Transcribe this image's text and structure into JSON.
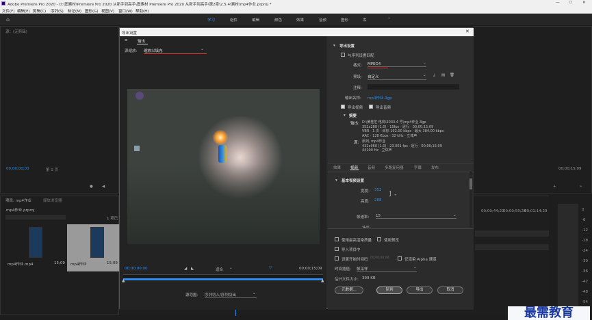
{
  "titlebar": {
    "title": "Adobe Premiere Pro 2020 - D:\\图素材\\Premiere Pro 2020 从新手到高手\\图素材 Premiere Pro 2020 从新手到高手\\第2章\\2.5.4\\素材\\mp4作业.prproj *"
  },
  "menu": [
    "文件(F)",
    "编辑(E)",
    "剪辑(C)",
    "序列(S)",
    "标记(M)",
    "图形(G)",
    "视图(V)",
    "窗口(W)",
    "帮助(H)"
  ],
  "workspaces": [
    "学习",
    "组件",
    "编辑",
    "颜色",
    "效果",
    "音频",
    "图形",
    "库"
  ],
  "panels": {
    "source": "源：(无剪辑)",
    "source_tc": "00;00;00;00",
    "source_page": "第 1 页",
    "program_tc": "00;00;15;09",
    "project_tabs": [
      "项目: mp4作业",
      "媒体浏览器"
    ],
    "project_file": "mp4作业.prproj",
    "items_count": "1 项已",
    "media": [
      {
        "name": "mp4作业.mp4",
        "dur": "15;09"
      },
      {
        "name": "mp4作业",
        "dur": "15;09"
      }
    ],
    "timeline_tcs": [
      "00;00;44;29",
      "00;00;59;28",
      "00;01;14;29",
      "00;01;29;29"
    ],
    "meter_ticks": [
      "0",
      "-6",
      "-12",
      "-18",
      "-24",
      "-30",
      "-36",
      "-42",
      "-48",
      "-54"
    ]
  },
  "dialog": {
    "title": "导出设置",
    "left": {
      "tab": "输出",
      "source_scaling_label": "源缩放:",
      "source_scaling_value": "缩放以填充",
      "tc_start": "00;00;00;00",
      "tc_end": "00;00;15;09",
      "fit": "适合",
      "range_label": "源范围:",
      "range_value": "序列切入/序列切出"
    },
    "right": {
      "export_settings": "导出设置",
      "match_seq": "与序列设置匹配",
      "format_label": "格式:",
      "format_value": "MPEG4",
      "preset_label": "预设:",
      "preset_value": "自定义",
      "comments_label": "注释:",
      "output_name_label": "输出名称:",
      "output_name_value": "mp4作业.3gp",
      "export_video": "导出视频",
      "export_audio": "导出音频",
      "summary": "摘要",
      "output_label": "输出:",
      "output_lines": [
        "D:\\黄桂芝 电商\\2033.4 号\\mp4作业.3gp",
        "352x288 (1.0) · 15fps · 逐行 · 00;00;15;09",
        "VBR · 1 次 · 目标 192.00 kbps · 最大 384.00 kbps",
        "AAC · 128 Kbps · 32 kHz · 立体声"
      ],
      "source_label": "源:",
      "source_lines": [
        "序列, mp4作业",
        "432x960 (1.0) · 23.001 fps · 逐行 · 00;00;15;09",
        "44100 Hz · 立体声"
      ],
      "tabs": [
        "效果",
        "视频",
        "音频",
        "多路复用器",
        "字幕",
        "发布"
      ],
      "basic_video": "基本视频设置",
      "width_label": "宽度:",
      "width_value": "352",
      "height_label": "高度:",
      "height_value": "288",
      "frame_rate_label": "帧速率:",
      "frame_rate_value": "15",
      "field_order_label": "场序:",
      "max_render": "使用最高渲染质量",
      "use_previews": "使用预览",
      "import_project": "导入项目中",
      "set_start_tc": "设置开始时间码",
      "set_start_tc_value": "00;00;00;00",
      "render_alpha": "仅渲染 Alpha 通道",
      "interp_label": "时间插值:",
      "interp_value": "帧采样",
      "file_size_label": "估计文件大小:",
      "file_size_value": "399 KB",
      "buttons": {
        "metadata": "元数据...",
        "queue": "队列",
        "export": "导出",
        "cancel": "取消"
      }
    }
  },
  "watermark": "最需教育"
}
